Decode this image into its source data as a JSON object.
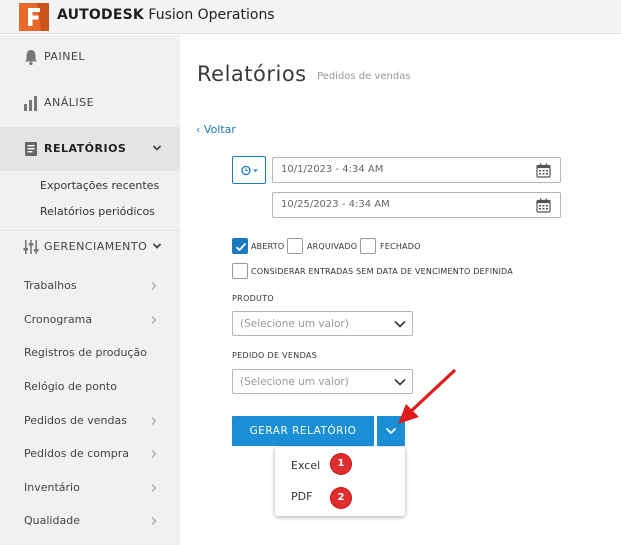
{
  "app": {
    "brand_bold": "AUTODESK",
    "brand_rest": "Fusion Operations",
    "accent": "#1a8fd6",
    "logo_color": "#e8692a"
  },
  "sidebar": {
    "top_items": [
      {
        "label": "PAINEL",
        "icon": "bell-icon"
      },
      {
        "label": "ANÁLISE",
        "icon": "bar-chart-icon"
      },
      {
        "label": "RELATÓRIOS",
        "icon": "report-icon",
        "active": true
      }
    ],
    "report_subitems": [
      "Exportações recentes",
      "Relatórios periódicos"
    ],
    "management_label": "GERENCIAMENTO",
    "items": [
      "Trabalhos",
      "Cronograma",
      "Registros de produção",
      "Relógio de ponto",
      "Pedidos de vendas",
      "Pedidos de compra",
      "Inventário",
      "Qualidade"
    ]
  },
  "main": {
    "title": "Relatórios",
    "subtitle": "Pedidos de vendas",
    "back": "‹ Voltar",
    "date_from": "10/1/2023 - 4:34 AM",
    "date_to": "10/25/2023 - 4:34 AM",
    "status_filters": [
      {
        "label": "ABERTO",
        "checked": true
      },
      {
        "label": "ARQUIVADO",
        "checked": false
      },
      {
        "label": "FECHADO",
        "checked": false
      }
    ],
    "no_due_date_label": "CONSIDERAR ENTRADAS SEM DATA DE VENCIMENTO DEFINIDA",
    "product_label": "PRODUTO",
    "product_placeholder": "(Selecione um valor)",
    "sales_order_label": "PEDIDO DE VENDAS",
    "sales_order_placeholder": "(Selecione um valor)",
    "generate_button": "GERAR RELATÓRIO",
    "menu": [
      {
        "label": "Excel",
        "badge": "1"
      },
      {
        "label": "PDF",
        "badge": "2"
      }
    ]
  }
}
